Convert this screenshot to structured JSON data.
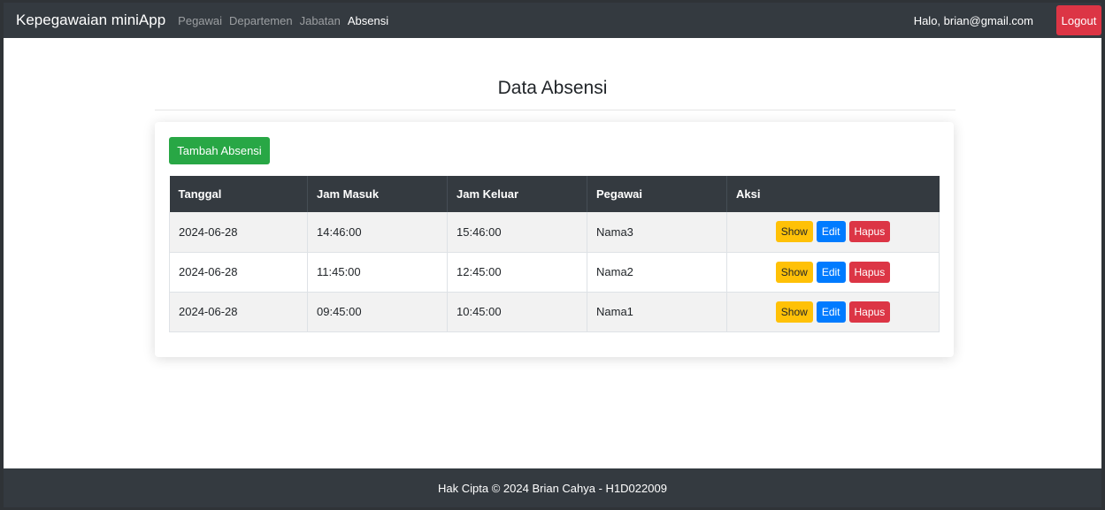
{
  "navbar": {
    "brand": "Kepegawaian miniApp",
    "links": [
      "Pegawai",
      "Departemen",
      "Jabatan",
      "Absensi"
    ],
    "active": "Absensi",
    "greeting": "Halo, brian@gmail.com",
    "logout_label": "Logout"
  },
  "page": {
    "title": "Data Absensi",
    "add_button": "Tambah Absensi"
  },
  "table": {
    "headers": [
      "Tanggal",
      "Jam Masuk",
      "Jam Keluar",
      "Pegawai",
      "Aksi"
    ],
    "rows": [
      {
        "tanggal": "2024-06-28",
        "jam_masuk": "14:46:00",
        "jam_keluar": "15:46:00",
        "pegawai": "Nama3"
      },
      {
        "tanggal": "2024-06-28",
        "jam_masuk": "11:45:00",
        "jam_keluar": "12:45:00",
        "pegawai": "Nama2"
      },
      {
        "tanggal": "2024-06-28",
        "jam_masuk": "09:45:00",
        "jam_keluar": "10:45:00",
        "pegawai": "Nama1"
      }
    ],
    "actions": {
      "show": "Show",
      "edit": "Edit",
      "hapus": "Hapus"
    }
  },
  "footer": {
    "text": "Hak Cipta © 2024 Brian Cahya - H1D022009"
  },
  "colors": {
    "navbar_bg": "#343a40",
    "success": "#28a745",
    "warning": "#ffc107",
    "primary": "#007bff",
    "danger": "#dc3545"
  }
}
